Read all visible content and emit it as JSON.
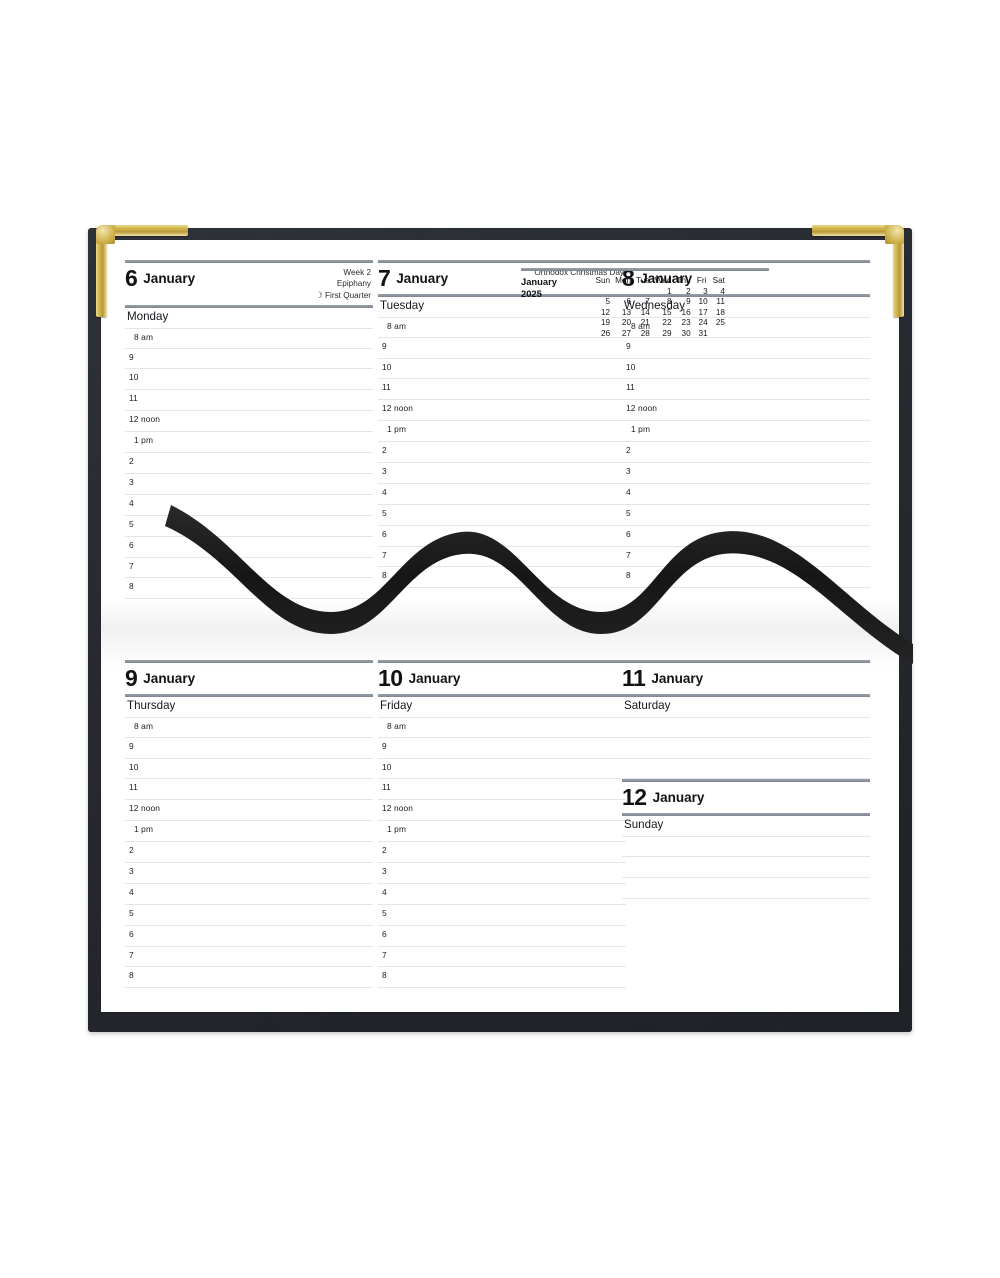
{
  "product": {
    "name": "week-to-view-desk-diary",
    "cover_color": "#23262c",
    "corner_color": "#d4b94e",
    "ribbon_color": "#1a1a1a"
  },
  "hour_labels": [
    "8 am",
    "9",
    "10",
    "11",
    "12 noon",
    "1 pm",
    "2",
    "3",
    "4",
    "5",
    "6",
    "7",
    "8"
  ],
  "days": [
    {
      "num": "6",
      "month": "January",
      "weekday": "Monday",
      "notes": [
        "Week 2",
        "Epiphany",
        "First Quarter"
      ],
      "moon_glyph": "☽",
      "has_moon": true,
      "layout": "hours"
    },
    {
      "num": "7",
      "month": "January",
      "weekday": "Tuesday",
      "notes": [
        "Orthodox Christmas Day"
      ],
      "moon_glyph": "",
      "has_moon": false,
      "layout": "hours"
    },
    {
      "num": "8",
      "month": "January",
      "weekday": "Wednesday",
      "notes": [],
      "moon_glyph": "",
      "has_moon": false,
      "layout": "hours"
    },
    {
      "num": "9",
      "month": "January",
      "weekday": "Thursday",
      "notes": [],
      "moon_glyph": "",
      "has_moon": false,
      "layout": "hours"
    },
    {
      "num": "10",
      "month": "January",
      "weekday": "Friday",
      "notes": [],
      "moon_glyph": "",
      "has_moon": false,
      "layout": "hours"
    },
    {
      "num": "11",
      "month": "January",
      "weekday": "Saturday",
      "notes": [],
      "moon_glyph": "",
      "has_moon": false,
      "layout": "blank",
      "blank_lines": 3
    },
    {
      "num": "12",
      "month": "January",
      "weekday": "Sunday",
      "notes": [],
      "moon_glyph": "",
      "has_moon": false,
      "layout": "blank",
      "blank_lines": 3
    }
  ],
  "minical": {
    "month": "January",
    "year": "2025",
    "weekday_headers": [
      "Sun",
      "Mon",
      "Tue",
      "Wed",
      "Thu",
      "Fri",
      "Sat"
    ],
    "weeks": [
      [
        "",
        "",
        "",
        "1",
        "2",
        "3",
        "4"
      ],
      [
        "5",
        "6",
        "7",
        "8",
        "9",
        "10",
        "11"
      ],
      [
        "12",
        "13",
        "14",
        "15",
        "16",
        "17",
        "18"
      ],
      [
        "19",
        "20",
        "21",
        "22",
        "23",
        "24",
        "25"
      ],
      [
        "26",
        "27",
        "28",
        "29",
        "30",
        "31",
        ""
      ]
    ]
  }
}
